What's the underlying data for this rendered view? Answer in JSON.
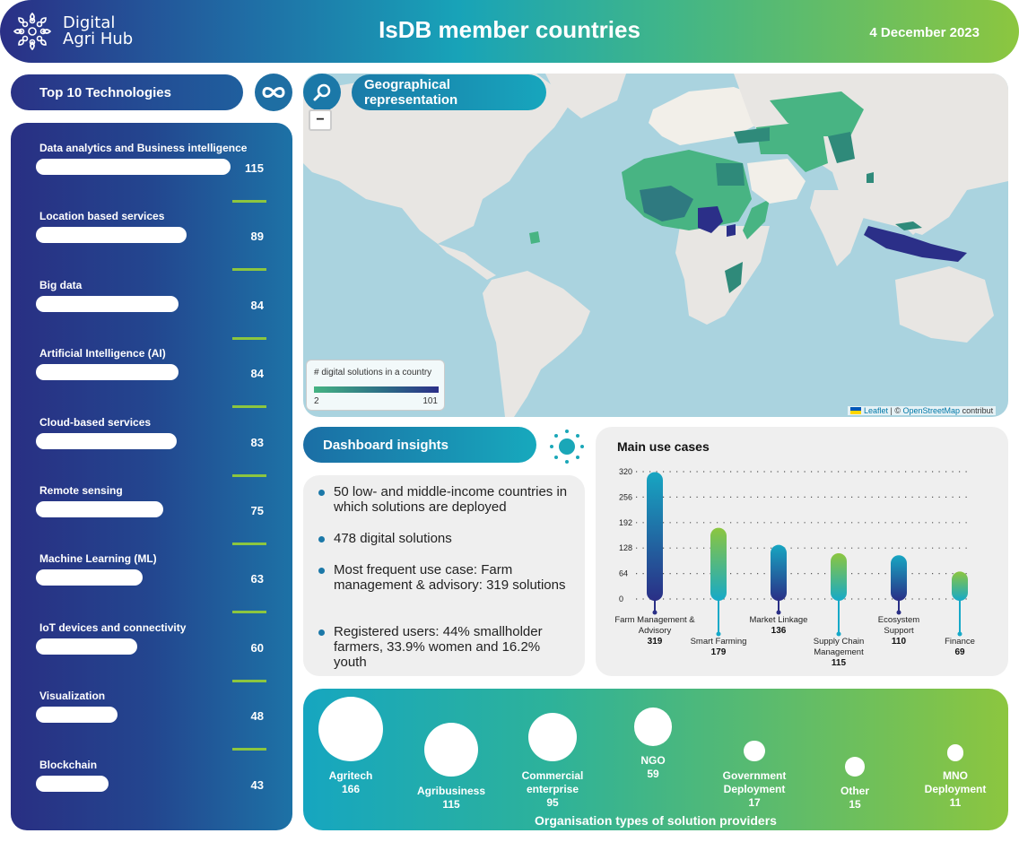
{
  "header": {
    "logo_line1": "Digital",
    "logo_line2": "Agri Hub",
    "title": "IsDB member countries",
    "date": "4 December 2023"
  },
  "icons": {
    "logo": "leaf-network-icon",
    "infinity": "infinity-icon",
    "search": "search-icon",
    "sun": "sun-icon"
  },
  "technologies": {
    "title": "Top 10 Technologies",
    "max": 115,
    "items": [
      {
        "label": "Data analytics and Business intelligence",
        "value": 115
      },
      {
        "label": "Location based services",
        "value": 89
      },
      {
        "label": "Big data",
        "value": 84
      },
      {
        "label": "Artificial Intelligence (AI)",
        "value": 84
      },
      {
        "label": "Cloud-based services",
        "value": 83
      },
      {
        "label": "Remote sensing",
        "value": 75
      },
      {
        "label": "Machine Learning (ML)",
        "value": 63
      },
      {
        "label": "IoT devices and connectivity",
        "value": 60
      },
      {
        "label": "Visualization",
        "value": 48
      },
      {
        "label": "Blockchain",
        "value": 43
      }
    ]
  },
  "map": {
    "title": "Geographical representation",
    "zoom_out_label": "−",
    "legend_title": "# digital solutions in a country",
    "legend_min": "2",
    "legend_max": "101",
    "legend_colors": [
      "#45b383",
      "#2b2f88"
    ],
    "attribution_leaflet": "Leaflet",
    "attribution_sep": " | © ",
    "attribution_osm": "OpenStreetMap",
    "attribution_rest": " contribut"
  },
  "insights": {
    "title": "Dashboard insights",
    "items": [
      "50 low- and middle-income countries in which solutions are deployed",
      "478 digital solutions",
      "Most frequent use case: Farm management & advisory: 319 solutions",
      "Registered users: 44% smallholder farmers, 33.9% women and 16.2% youth"
    ]
  },
  "chart_data": {
    "type": "bar",
    "title": "Main use cases",
    "xlabel": "",
    "ylabel": "",
    "ylim": [
      0,
      320
    ],
    "yticks": [
      0,
      64,
      128,
      192,
      256,
      320
    ],
    "grid": true,
    "categories": [
      "Farm Management & Advisory",
      "Smart Farming",
      "Market Linkage",
      "Supply Chain Management",
      "Ecosystem Support",
      "Finance"
    ],
    "category_lines": [
      [
        "Farm Management &",
        "Advisory"
      ],
      [
        "Smart Farming"
      ],
      [
        "Market Linkage"
      ],
      [
        "Supply Chain",
        "Management"
      ],
      [
        "Ecosystem",
        "Support"
      ],
      [
        "Finance"
      ]
    ],
    "values": [
      319,
      179,
      136,
      115,
      110,
      69
    ],
    "bar_styles": [
      "blue",
      "green",
      "blue",
      "green",
      "blue",
      "green"
    ],
    "colors": {
      "blue_top": "#17a6c2",
      "blue_bottom": "#2a2f86",
      "green_top": "#8cc63f",
      "green_bottom": "#16a9c8"
    }
  },
  "organisations": {
    "title": "Organisation types of solution providers",
    "items": [
      {
        "label_lines": [
          "Agritech"
        ],
        "value": 166
      },
      {
        "label_lines": [
          "Agribusiness"
        ],
        "value": 115
      },
      {
        "label_lines": [
          "Commercial",
          "enterprise"
        ],
        "value": 95
      },
      {
        "label_lines": [
          "NGO"
        ],
        "value": 59
      },
      {
        "label_lines": [
          "Government",
          "Deployment"
        ],
        "value": 17
      },
      {
        "label_lines": [
          "Other"
        ],
        "value": 15
      },
      {
        "label_lines": [
          "MNO",
          "Deployment"
        ],
        "value": 11
      }
    ]
  }
}
